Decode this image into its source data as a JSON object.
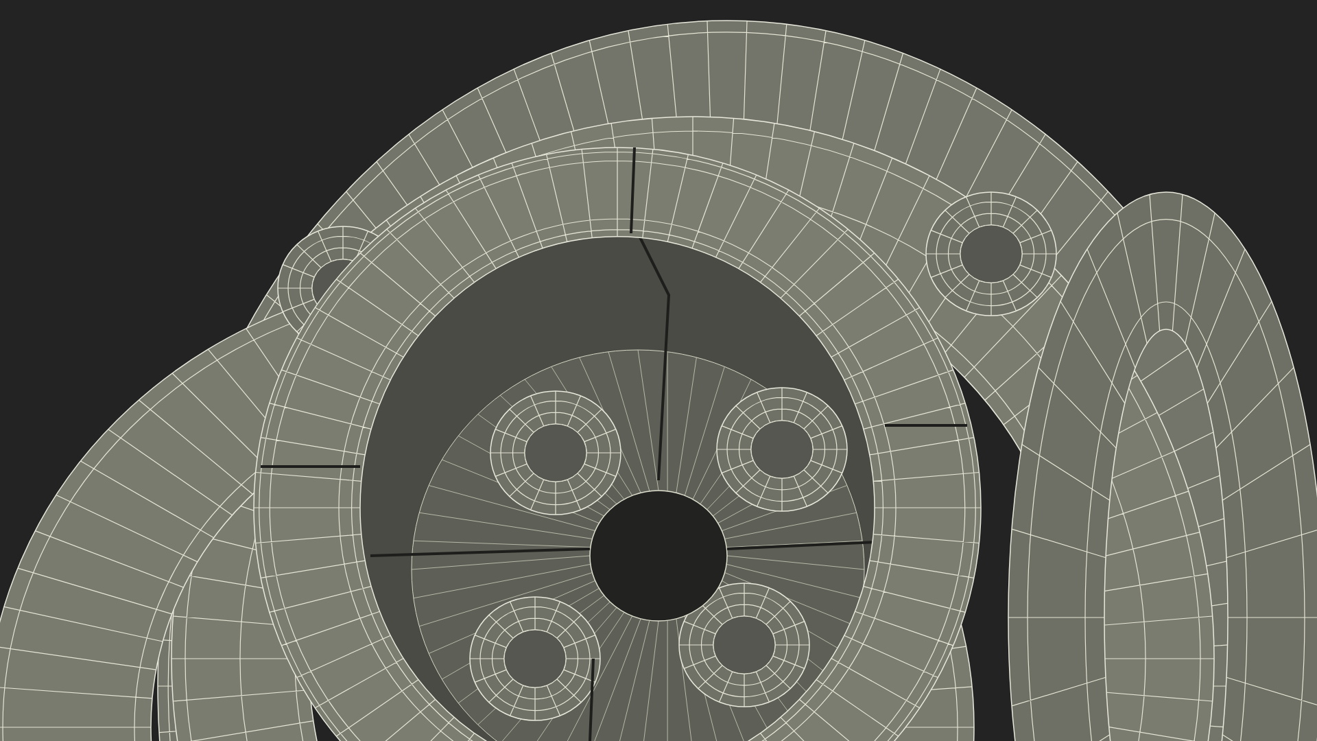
{
  "scene": {
    "kind": "wireframe"
  }
}
